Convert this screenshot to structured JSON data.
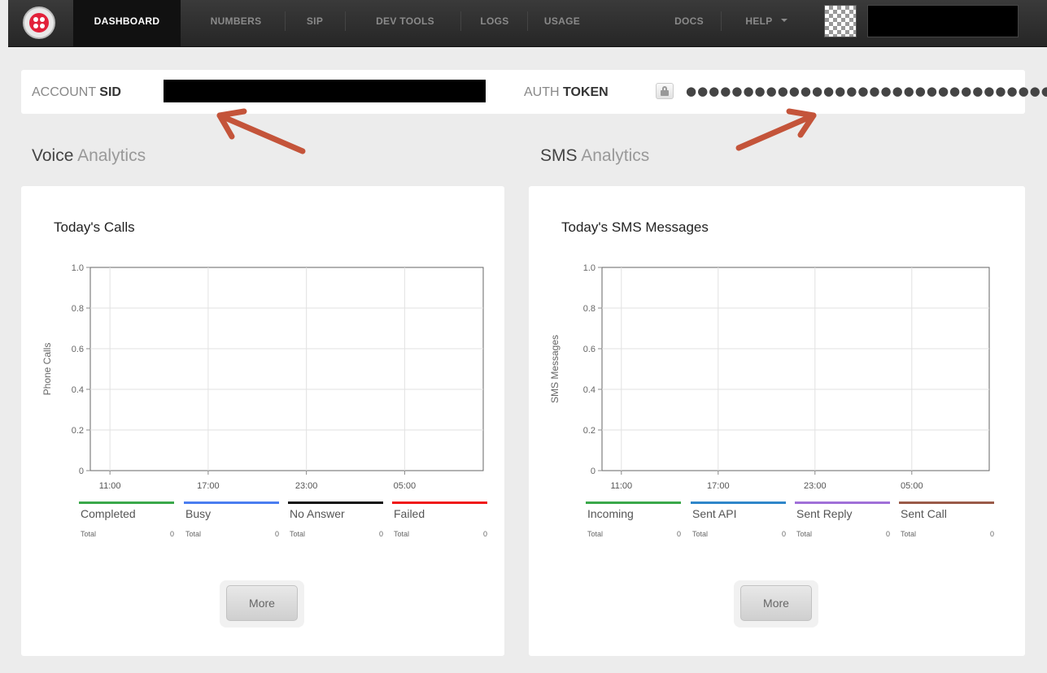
{
  "nav": {
    "items": [
      {
        "label": "DASHBOARD"
      },
      {
        "label": "NUMBERS"
      },
      {
        "label": "SIP"
      },
      {
        "label": "DEV TOOLS"
      },
      {
        "label": "LOGS"
      },
      {
        "label": "USAGE"
      }
    ],
    "docs": "DOCS",
    "help": "HELP"
  },
  "credentials": {
    "sid_prefix": "ACCOUNT",
    "sid_strong": "SID",
    "token_prefix": "AUTH",
    "token_strong": "TOKEN",
    "token_mask": "●●●●●●●●●●●●●●●●●●●●●●●●●●●●●●●●"
  },
  "sections": {
    "voice_bold": "Voice",
    "voice_rest": "Analytics",
    "sms_bold": "SMS",
    "sms_rest": "Analytics"
  },
  "panels": [
    {
      "title": "Today's Calls",
      "legend": [
        {
          "name": "Completed",
          "color": "#3aa84a",
          "total_label": "Total",
          "total": "0"
        },
        {
          "name": "Busy",
          "color": "#4a7df0",
          "total_label": "Total",
          "total": "0"
        },
        {
          "name": "No Answer",
          "color": "#111111",
          "total_label": "Total",
          "total": "0"
        },
        {
          "name": "Failed",
          "color": "#f01818",
          "total_label": "Total",
          "total": "0"
        }
      ],
      "more_label": "More"
    },
    {
      "title": "Today's SMS Messages",
      "legend": [
        {
          "name": "Incoming",
          "color": "#3aa84a",
          "total_label": "Total",
          "total": "0"
        },
        {
          "name": "Sent API",
          "color": "#2f86c9",
          "total_label": "Total",
          "total": "0"
        },
        {
          "name": "Sent Reply",
          "color": "#a070d8",
          "total_label": "Total",
          "total": "0"
        },
        {
          "name": "Sent Call",
          "color": "#9a5a48",
          "total_label": "Total",
          "total": "0"
        }
      ],
      "more_label": "More"
    }
  ],
  "chart_data": [
    {
      "type": "line",
      "title": "Today's Calls",
      "ylabel": "Phone Calls",
      "xlabel": "",
      "ylim": [
        0,
        1.0
      ],
      "y_ticks": [
        "0",
        "0.2",
        "0.4",
        "0.6",
        "0.8",
        "1.0"
      ],
      "x_ticks": [
        "11:00",
        "17:00",
        "23:00",
        "05:00"
      ],
      "grid": true,
      "legend_position": "bottom",
      "series": [
        {
          "name": "Completed",
          "values": []
        },
        {
          "name": "Busy",
          "values": []
        },
        {
          "name": "No Answer",
          "values": []
        },
        {
          "name": "Failed",
          "values": []
        }
      ]
    },
    {
      "type": "line",
      "title": "Today's SMS Messages",
      "ylabel": "SMS Messages",
      "xlabel": "",
      "ylim": [
        0,
        1.0
      ],
      "y_ticks": [
        "0",
        "0.2",
        "0.4",
        "0.6",
        "0.8",
        "1.0"
      ],
      "x_ticks": [
        "11:00",
        "17:00",
        "23:00",
        "05:00"
      ],
      "grid": true,
      "legend_position": "bottom",
      "series": [
        {
          "name": "Incoming",
          "values": []
        },
        {
          "name": "Sent API",
          "values": []
        },
        {
          "name": "Sent Reply",
          "values": []
        },
        {
          "name": "Sent Call",
          "values": []
        }
      ]
    }
  ]
}
